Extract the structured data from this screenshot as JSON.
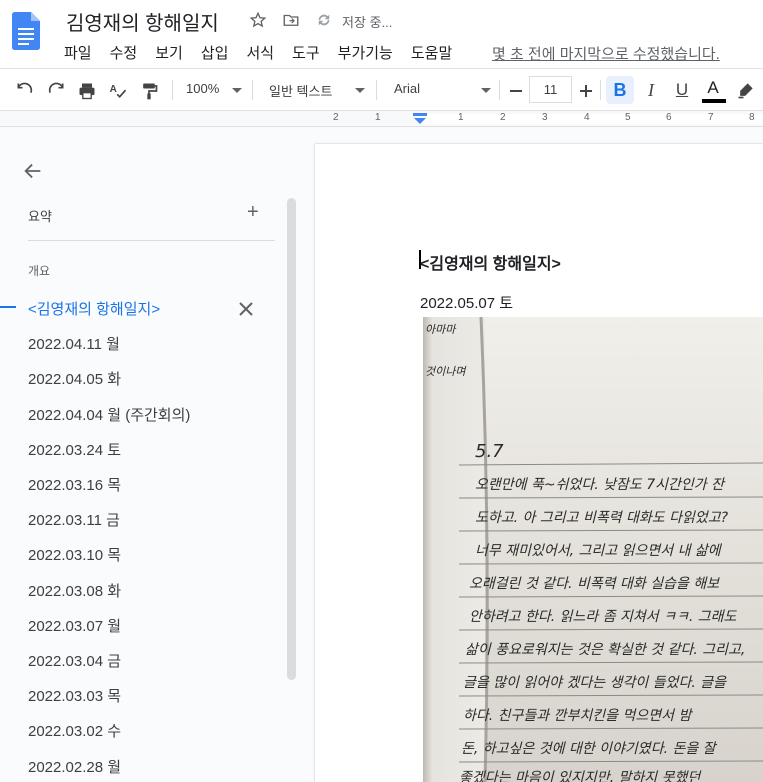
{
  "app": {
    "title": "김영재의 항해일지",
    "saving_status": "저장 중...",
    "last_edit": "몇 초 전에 마지막으로 수정했습니다."
  },
  "menu": [
    "파일",
    "수정",
    "보기",
    "삽입",
    "서식",
    "도구",
    "부가기능",
    "도움말"
  ],
  "toolbar": {
    "zoom": "100%",
    "style": "일반 텍스트",
    "font": "Arial",
    "font_size": "11",
    "bold": "B",
    "italic": "I",
    "underline": "U",
    "text_color": "A"
  },
  "ruler": [
    "2",
    "1",
    "1",
    "2",
    "3",
    "4",
    "5",
    "6",
    "7",
    "8"
  ],
  "sidebar": {
    "summary_label": "요약",
    "outline_label": "개요",
    "items": [
      "<김영재의 항해일지>",
      "2022.04.11 월",
      "2022.04.05 화",
      "2022.04.04 월 (주간회의)",
      "2022.03.24 토",
      "2022.03.16 목",
      "2022.03.11 금",
      "2022.03.10 목",
      "2022.03.08 화",
      "2022.03.07 월",
      "2022.03.04 금",
      "2022.03.03 목",
      "2022.03.02 수",
      "2022.02.28 월"
    ]
  },
  "document": {
    "heading": "<김영재의 항해일지>",
    "date": "2022.05.07 토"
  },
  "photo": {
    "margin_note_1": "아마마",
    "margin_note_2": "것이나며",
    "date_note": "5.7",
    "lines": [
      "오랜만에 푹~쉬었다. 낮잠도 7시간인가 잔",
      "도하고. 아 그리고 비폭력 대화도 다읽었고?",
      "너무 재미있어서, 그리고 읽으면서 내 삶에",
      "오래걸린 것 같다. 비폭력 대화 실습을 해보",
      "안하려고 한다. 읽느라 좀 지쳐서 ㅋㅋ. 그래도",
      "삶이 풍요로워지는 것은 확실한 것 같다. 그리고,",
      "글을 많이 읽어야 겠다는 생각이 들었다. 글을",
      "하다. 친구들과 깐부치킨을 먹으면서 밤",
      "돈, 하고싶은 것에 대한 이야기였다. 돈을 잘",
      "좋겠다는 마음이 있지지만, 말하지 못했던"
    ]
  },
  "colors": {
    "accent": "#1a73e8",
    "doc_icon": "#4285f4"
  }
}
